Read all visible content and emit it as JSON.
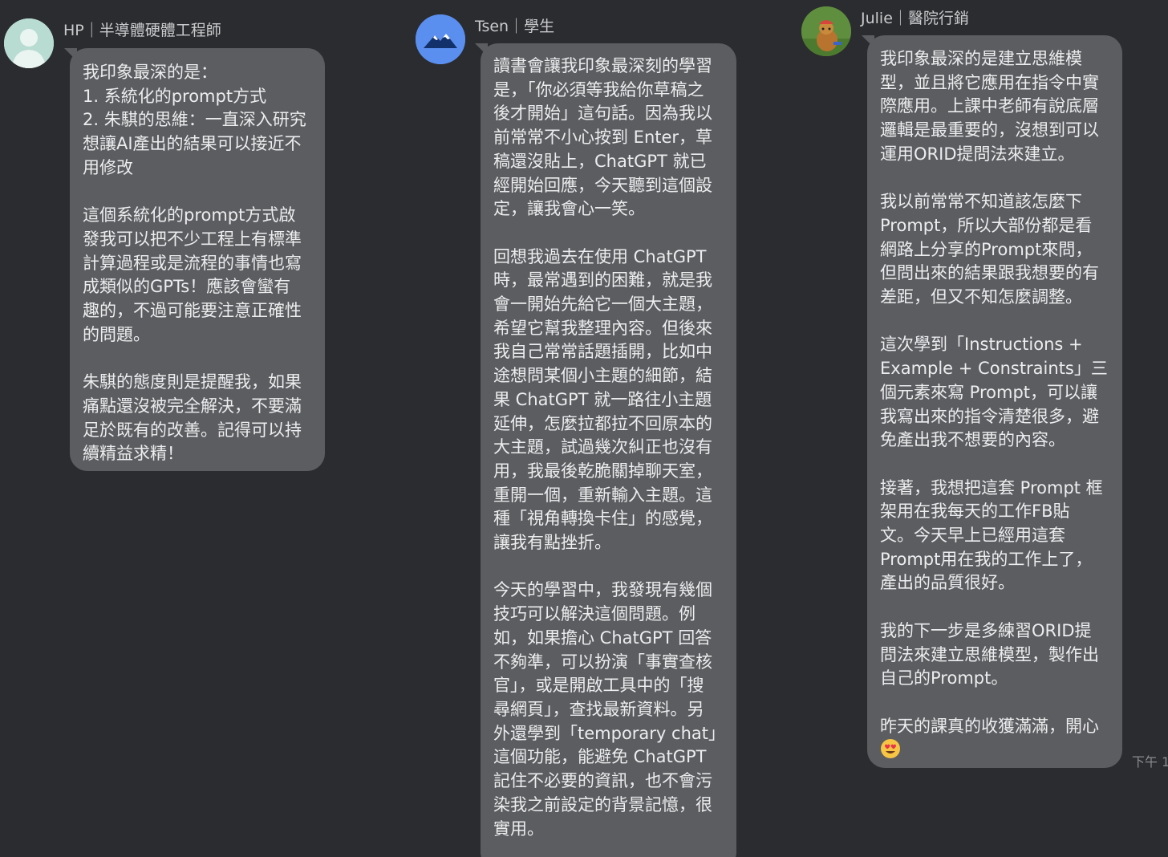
{
  "messages": [
    {
      "sender": "HP｜半導體硬體工程師",
      "lines": [
        "我印象最深的是：",
        "1. 系統化的prompt方式",
        "2. 朱騏的思維：一直深入研究",
        "想讓AI產出的結果可以接近不",
        "用修改",
        "",
        "這個系統化的prompt方式啟",
        "發我可以把不少工程上有標準",
        "計算過程或是流程的事情也寫",
        "成類似的GPTs！應該會蠻有",
        "趣的，不過可能要注意正確性",
        "的問題。",
        "",
        "朱騏的態度則是提醒我，如果",
        "痛點還沒被完全解決，不要滿",
        "足於既有的改善。記得可以持",
        "續精益求精！"
      ]
    },
    {
      "sender": "Tsen｜學生",
      "lines": [
        "讀書會讓我印象最深刻的學習",
        "是，「你必須等我給你草稿之",
        "後才開始」這句話。因為我以",
        "前常常不小心按到 Enter，草",
        "稿還沒貼上，ChatGPT 就已",
        "經開始回應，今天聽到這個設",
        "定，讓我會心一笑。",
        "",
        "回想我過去在使用 ChatGPT",
        "時，最常遇到的困難，就是我",
        "會一開始先給它一個大主題，",
        "希望它幫我整理內容。但後來",
        "我自己常常話題插開，比如中",
        "途想問某個小主題的細節，結",
        "果 ChatGPT 就一路往小主題",
        "延伸，怎麼拉都拉不回原本的",
        "大主題，試過幾次糾正也沒有",
        "用，我最後乾脆關掉聊天室，",
        "重開一個，重新輸入主題。這",
        "種「視角轉換卡住」的感覺，",
        "讓我有點挫折。",
        "",
        "今天的學習中，我發現有幾個",
        "技巧可以解決這個問題。例",
        "如，如果擔心 ChatGPT 回答",
        "不夠準，可以扮演「事實查核",
        "官」，或是開啟工具中的「搜",
        "尋網頁」，查找最新資料。另",
        "外還學到「temporary chat」",
        "這個功能，能避免 ChatGPT",
        "記住不必要的資訊，也不會污",
        "染我之前設定的背景記憶，很",
        "實用。"
      ]
    },
    {
      "sender": "Julie｜醫院行銷",
      "lines": [
        "我印象最深的是建立思維模",
        "型，並且將它應用在指令中實",
        "際應用。上課中老師有說底層",
        "邏輯是最重要的，沒想到可以",
        "運用ORID提問法來建立。",
        "",
        "我以前常常不知道該怎麼下",
        "Prompt，所以大部份都是看",
        "網路上分享的Prompt來問，",
        "但問出來的結果跟我想要的有",
        "差距，但又不知怎麼調整。",
        "",
        "這次學到「Instructions +",
        "Example + Constraints」三",
        "個元素來寫 Prompt，可以讓",
        "我寫出來的指令清楚很多，避",
        "免產出我不想要的內容。",
        "",
        "接著，我想把這套 Prompt 框",
        "架用在我每天的工作FB貼",
        "文。今天早上已經用這套",
        "Prompt用在我的工作上了，",
        "產出的品質很好。",
        "",
        "我的下一步是多練習ORID提",
        "問法來建立思維模型，製作出",
        "自己的Prompt。",
        "",
        "昨天的課真的收獲滿滿，開心"
      ],
      "emoji": "heart-eyes-emoji",
      "timestamp": "下午 1"
    }
  ],
  "colors": {
    "background": "#2b2c2f",
    "bubble": "#5c5d60",
    "text": "#ecedee",
    "sender_text": "#c9cacc",
    "emoji_face": "#f6c544",
    "emoji_heart": "#e8344a"
  }
}
